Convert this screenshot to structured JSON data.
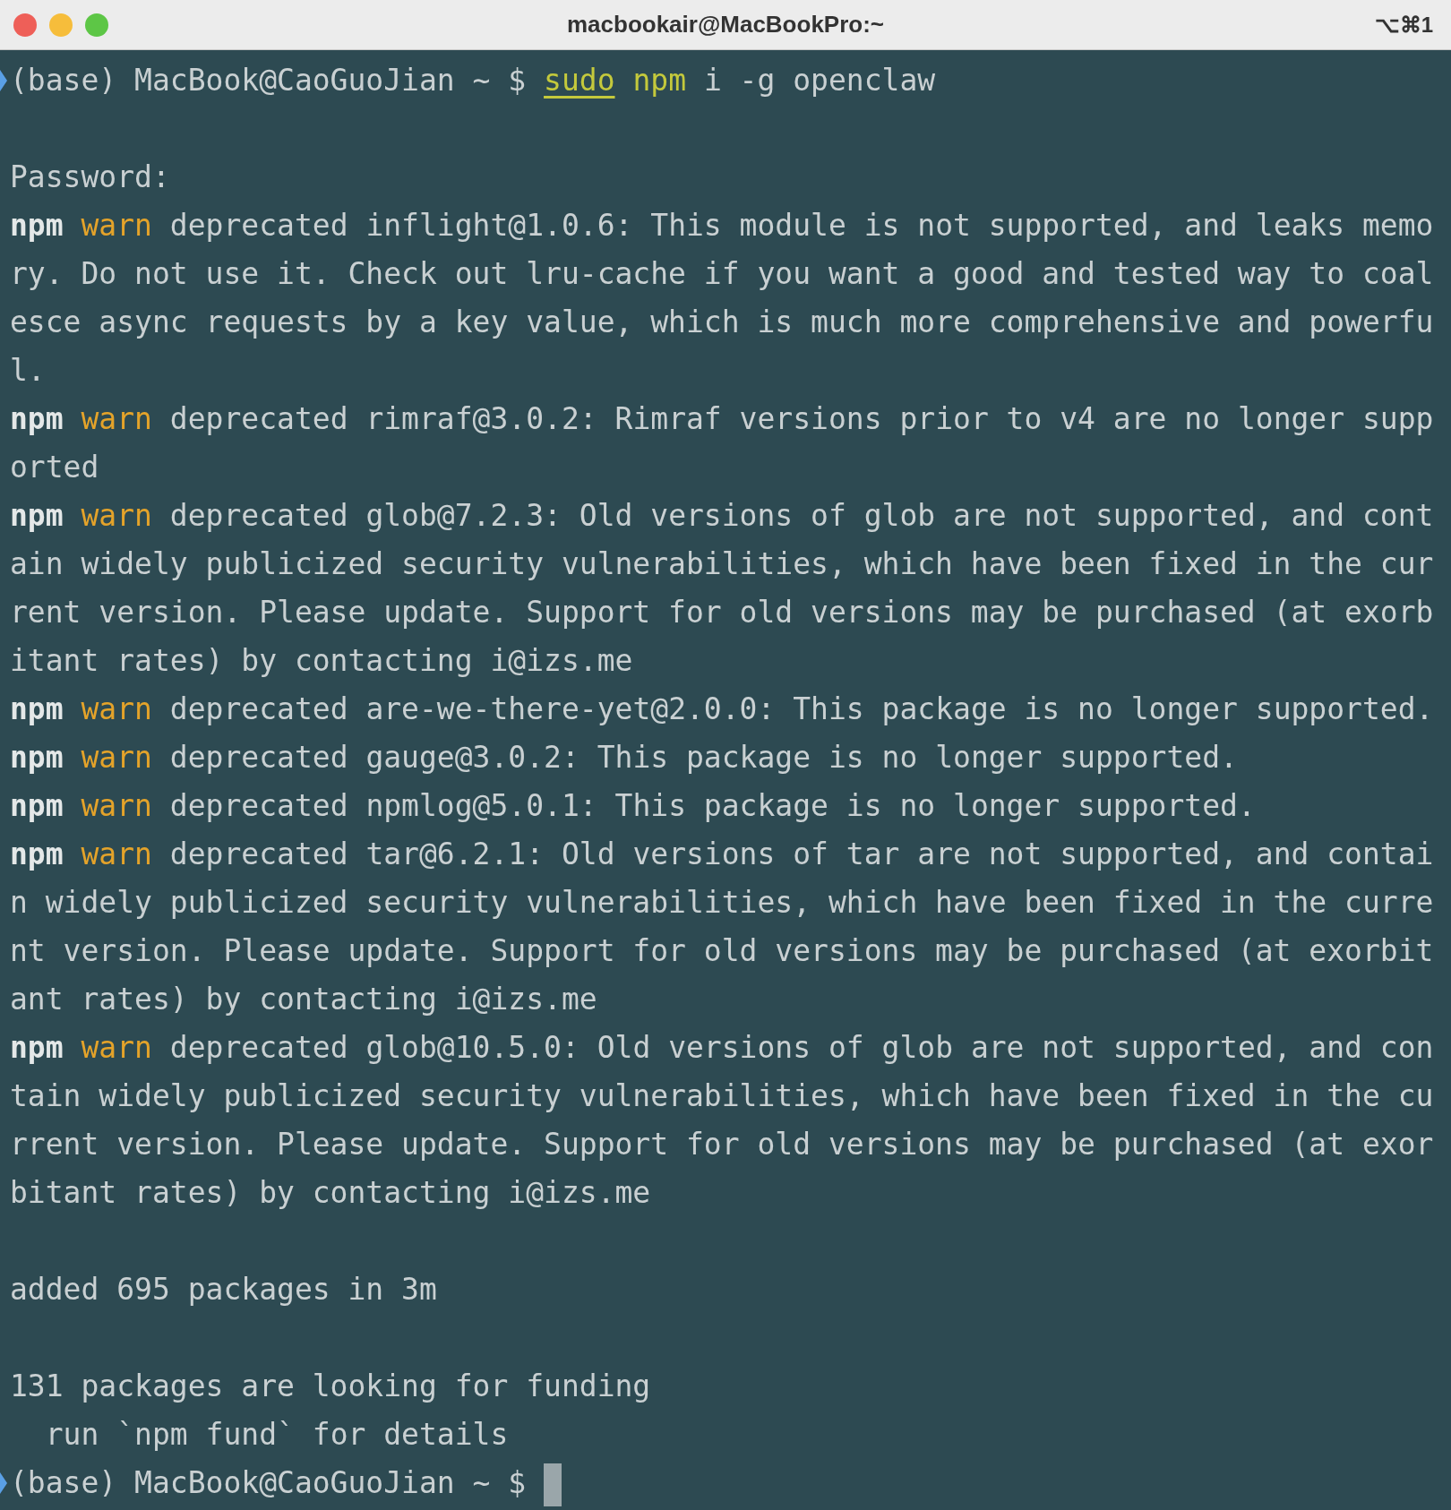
{
  "window": {
    "title": "macbookair@MacBookPro:~",
    "shortcut": "⌥⌘1"
  },
  "lines": [
    {
      "kind": "prompt",
      "prompt": "(base) MacBook@CaoGuoJian ~ $ ",
      "tokens": [
        {
          "kind": "prefix",
          "text": "sudo"
        },
        {
          "kind": "command",
          "text": "npm"
        },
        {
          "kind": "argument",
          "text": "i -g openclaw"
        }
      ],
      "cursor": false
    },
    {
      "kind": "blank"
    },
    {
      "kind": "plain",
      "text": "Password:"
    },
    {
      "kind": "warn",
      "source": "npm",
      "level_label": "warn",
      "text": "deprecated inflight@1.0.6: This module is not supported, and leaks memory. Do not use it. Check out lru-cache if you want a good and tested way to coalesce async requests by a key value, which is much more comprehensive and powerful."
    },
    {
      "kind": "warn",
      "source": "npm",
      "level_label": "warn",
      "text": "deprecated rimraf@3.0.2: Rimraf versions prior to v4 are no longer supported"
    },
    {
      "kind": "warn",
      "source": "npm",
      "level_label": "warn",
      "text": "deprecated glob@7.2.3: Old versions of glob are not supported, and contain widely publicized security vulnerabilities, which have been fixed in the current version. Please update. Support for old versions may be purchased (at exorbitant rates) by contacting i@izs.me"
    },
    {
      "kind": "warn",
      "source": "npm",
      "level_label": "warn",
      "text": "deprecated are-we-there-yet@2.0.0: This package is no longer supported."
    },
    {
      "kind": "warn",
      "source": "npm",
      "level_label": "warn",
      "text": "deprecated gauge@3.0.2: This package is no longer supported."
    },
    {
      "kind": "warn",
      "source": "npm",
      "level_label": "warn",
      "text": "deprecated npmlog@5.0.1: This package is no longer supported."
    },
    {
      "kind": "warn",
      "source": "npm",
      "level_label": "warn",
      "text": "deprecated tar@6.2.1: Old versions of tar are not supported, and contain widely publicized security vulnerabilities, which have been fixed in the current version. Please update. Support for old versions may be purchased (at exorbitant rates) by contacting i@izs.me"
    },
    {
      "kind": "warn",
      "source": "npm",
      "level_label": "warn",
      "text": "deprecated glob@10.5.0: Old versions of glob are not supported, and contain widely publicized security vulnerabilities, which have been fixed in the current version. Please update. Support for old versions may be purchased (at exorbitant rates) by contacting i@izs.me"
    },
    {
      "kind": "blank"
    },
    {
      "kind": "plain",
      "text": "added 695 packages in 3m"
    },
    {
      "kind": "blank"
    },
    {
      "kind": "plain",
      "text": "131 packages are looking for funding"
    },
    {
      "kind": "plain",
      "text": "  run `npm fund` for details"
    },
    {
      "kind": "prompt",
      "prompt": "(base) MacBook@CaoGuoJian ~ $ ",
      "cursor": true
    }
  ]
}
